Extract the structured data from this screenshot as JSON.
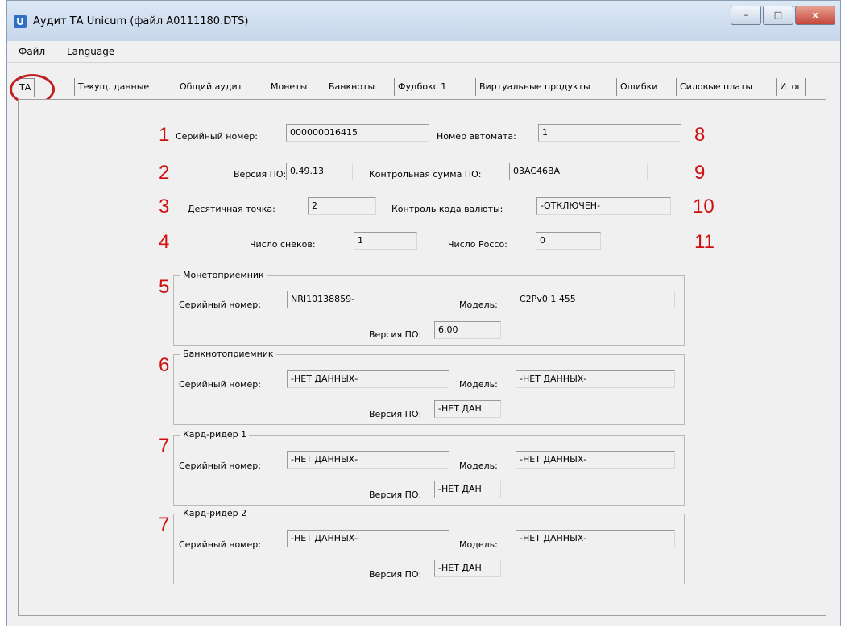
{
  "window": {
    "title": "Аудит ТА Unicum (файл A0111180.DTS)",
    "icon_letter": "U",
    "controls": {
      "minimize": "–",
      "maximize": "□",
      "close": "x"
    }
  },
  "menu": [
    "Файл",
    "Language"
  ],
  "tabs": [
    "ТА",
    "Текущ. данные",
    "Общий аудит",
    "Монеты",
    "Банкноты",
    "Фудбокс 1",
    "Виртуальные продукты",
    "Ошибки",
    "Силовые платы",
    "Итог"
  ],
  "active_tab": "ТА",
  "fields": {
    "serial_label": "Серийный номер:",
    "serial_value": "000000016415",
    "machine_no_label": "Номер автомата:",
    "machine_no_value": "1",
    "sw_version_label": "Версия ПО:",
    "sw_version_value": "0.49.13",
    "checksum_label": "Контрольная сумма ПО:",
    "checksum_value": "03AC46BA",
    "decimal_label": "Десятичная точка:",
    "decimal_value": "2",
    "currency_label": "Контроль кода валюты:",
    "currency_value": "-ОТКЛЮЧЕН-",
    "snacks_label": "Число снеков:",
    "snacks_value": "1",
    "rocco_label": "Число Рocco:",
    "rocco_value": "0"
  },
  "groups": {
    "coin": {
      "title": "Монетоприемник",
      "serial_label": "Серийный номер:",
      "serial_value": "NRI10138859-",
      "model_label": "Модель:",
      "model_value": "C2Pv0 1  455",
      "version_label": "Версия ПО:",
      "version_value": "6.00"
    },
    "bill": {
      "title": "Банкнотоприемник",
      "serial_label": "Серийный номер:",
      "serial_value": "-НЕТ ДАННЫХ-",
      "model_label": "Модель:",
      "model_value": "-НЕТ ДАННЫХ-",
      "version_label": "Версия ПО:",
      "version_value": "-НЕТ ДАН"
    },
    "card1": {
      "title": "Кард-ридер 1",
      "serial_label": "Серийный номер:",
      "serial_value": "-НЕТ ДАННЫХ-",
      "model_label": "Модель:",
      "model_value": "-НЕТ ДАННЫХ-",
      "version_label": "Версия ПО:",
      "version_value": "-НЕТ ДАН"
    },
    "card2": {
      "title": "Кард-ридер 2",
      "serial_label": "Серийный номер:",
      "serial_value": "-НЕТ ДАННЫХ-",
      "model_label": "Модель:",
      "model_value": "-НЕТ ДАННЫХ-",
      "version_label": "Версия ПО:",
      "version_value": "-НЕТ ДАН"
    }
  },
  "annotations": [
    "1",
    "2",
    "3",
    "4",
    "5",
    "6",
    "7",
    "7",
    "8",
    "9",
    "10",
    "11"
  ],
  "colors": {
    "annotation": "#d01010",
    "window_bg": "#f0f0f0"
  }
}
